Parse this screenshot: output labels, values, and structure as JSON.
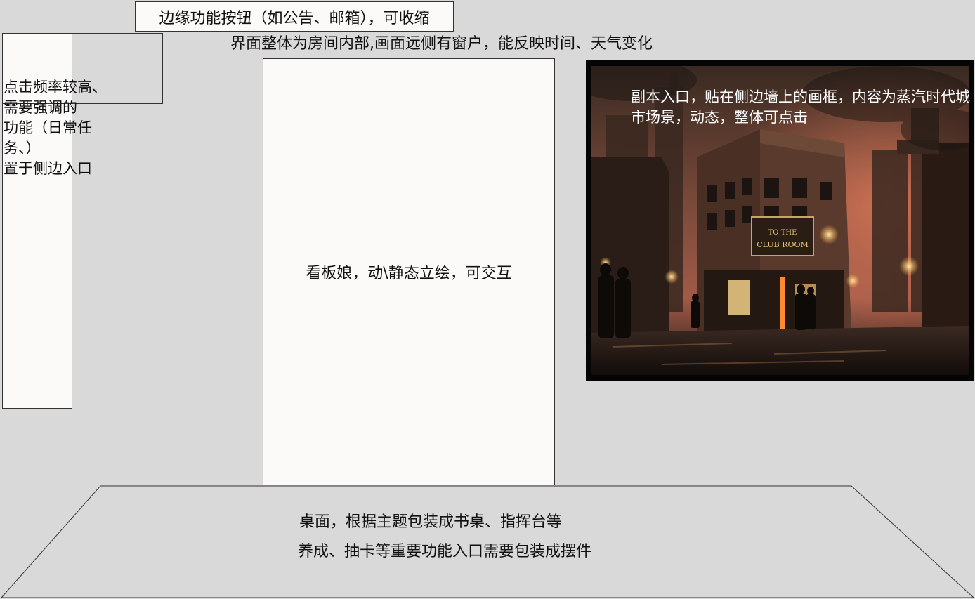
{
  "top_button_note": "边缘功能按钮（如公告、邮箱），可收缩",
  "room_note": "界面整体为房间内部,画面远侧有窗户，能反映时间、天气变化",
  "left_panel_note": {
    "lines": [
      "点击频率较高、",
      "需要强调的",
      "功能（日常任",
      "务、）",
      "置于侧边入口"
    ]
  },
  "character_note": "看板娘，动\\静态立绘，可交互",
  "dungeon_frame": {
    "note": "副本入口，贴在侧边墙上的画框，内容为蒸汽时代城市场景，动态，整体可点击",
    "sign_text": "TO THE CLUB ROOM"
  },
  "desk_note": {
    "line1": "桌面，根据主题包装成书桌、指挥台等",
    "line2": "养成、抽卡等重要功能入口需要包装成摆件"
  },
  "colors": {
    "background": "#d9d9d9",
    "panel": "#fbfaf8",
    "border": "#333333",
    "frame": "#050505"
  }
}
